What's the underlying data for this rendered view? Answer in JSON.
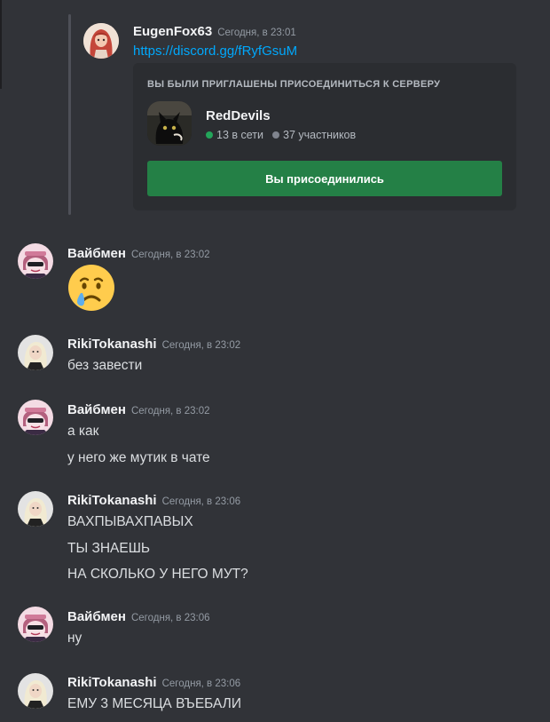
{
  "forwarded": {
    "author": "EugenFox63",
    "timestamp": "Сегодня, в 23:01",
    "link": "https://discord.gg/fRyfGsuM",
    "invite": {
      "heading": "ВЫ БЫЛИ ПРИГЛАШЕНЫ ПРИСОЕДИНИТЬСЯ К СЕРВЕРУ",
      "server_name": "RedDevils",
      "online": "13 в сети",
      "members": "37 участников",
      "button_label": "Вы присоединились"
    }
  },
  "messages": [
    {
      "author": "Вайбмен",
      "timestamp": "Сегодня, в 23:02",
      "avatar": "anime-avatar",
      "emoji": "crying-face"
    },
    {
      "author": "RikiTokanashi",
      "timestamp": "Сегодня, в 23:02",
      "avatar": "blonde-avatar",
      "lines": [
        "без завести"
      ]
    },
    {
      "author": "Вайбмен",
      "timestamp": "Сегодня, в 23:02",
      "avatar": "anime-avatar",
      "lines": [
        "а как",
        "у него же мутик в чате"
      ]
    },
    {
      "author": "RikiTokanashi",
      "timestamp": "Сегодня, в 23:06",
      "avatar": "blonde-avatar",
      "lines": [
        "ВАХПЫВАХПАВЫХ",
        "ТЫ ЗНАЕШЬ",
        "НА СКОЛЬКО У НЕГО МУТ?"
      ]
    },
    {
      "author": "Вайбмен",
      "timestamp": "Сегодня, в 23:06",
      "avatar": "anime-avatar",
      "lines": [
        "ну"
      ]
    },
    {
      "author": "RikiTokanashi",
      "timestamp": "Сегодня, в 23:06",
      "avatar": "blonde-avatar",
      "lines": [
        "ЕМУ 3 МЕСЯЦА ВЪЕБАЛИ"
      ]
    }
  ],
  "colors": {
    "background": "#313338",
    "card": "#2b2d31",
    "link": "#00a8fc",
    "join_button": "#248046",
    "online_dot": "#23a55a"
  }
}
